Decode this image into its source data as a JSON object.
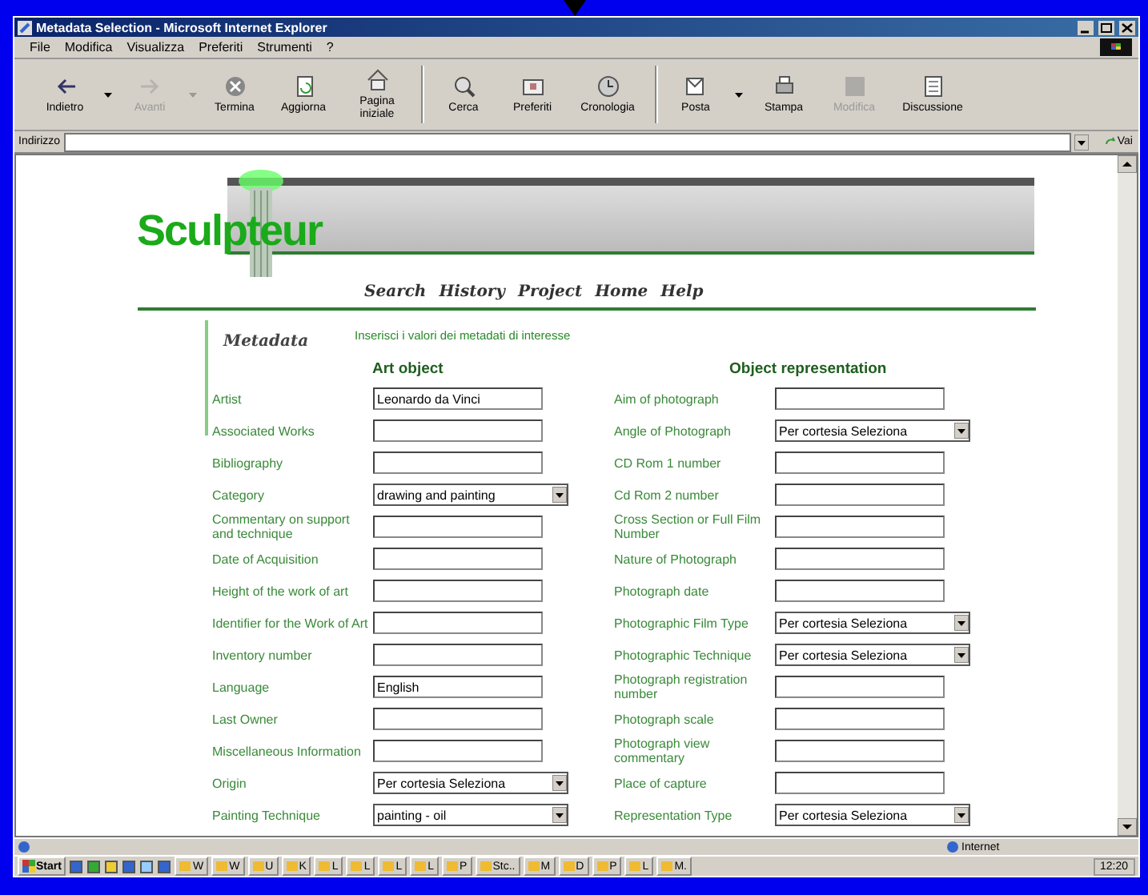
{
  "window": {
    "title": "Metadata Selection - Microsoft Internet Explorer"
  },
  "menu": [
    "File",
    "Modifica",
    "Visualizza",
    "Preferiti",
    "Strumenti",
    "?"
  ],
  "toolbar": [
    {
      "label": "Indietro",
      "disabled": false,
      "dropdown": true
    },
    {
      "label": "Avanti",
      "disabled": true,
      "dropdown": true
    },
    {
      "label": "Termina",
      "disabled": false,
      "dropdown": false
    },
    {
      "label": "Aggiorna",
      "disabled": false,
      "dropdown": false
    },
    {
      "label": "Pagina iniziale",
      "disabled": false,
      "dropdown": false
    },
    {
      "label": "Cerca",
      "disabled": false,
      "dropdown": false
    },
    {
      "label": "Preferiti",
      "disabled": false,
      "dropdown": false
    },
    {
      "label": "Cronologia",
      "disabled": false,
      "dropdown": false
    },
    {
      "label": "Posta",
      "disabled": false,
      "dropdown": true
    },
    {
      "label": "Stampa",
      "disabled": false,
      "dropdown": false
    },
    {
      "label": "Modifica",
      "disabled": true,
      "dropdown": false
    },
    {
      "label": "Discussione",
      "disabled": false,
      "dropdown": false
    }
  ],
  "address": {
    "label": "Indirizzo",
    "go": "Vai"
  },
  "page": {
    "logo": "Sculpteur",
    "nav": [
      "Search",
      "History",
      "Project",
      "Home",
      "Help"
    ],
    "section": "Metadata",
    "instruction": "Inserisci i valori dei metadati di interesse",
    "columns": [
      {
        "heading": "Art object",
        "fields": [
          {
            "label": "Artist",
            "kind": "text",
            "value": "Leonardo da Vinci"
          },
          {
            "label": "Associated Works",
            "kind": "text"
          },
          {
            "label": "Bibliography",
            "kind": "text"
          },
          {
            "label": "Category",
            "kind": "select",
            "value": "drawing and painting"
          },
          {
            "label": "Commentary on support and technique",
            "kind": "text"
          },
          {
            "label": "Date of Acquisition",
            "kind": "text"
          },
          {
            "label": "Height of the work of art",
            "kind": "text"
          },
          {
            "label": "Identifier for the Work of Art",
            "kind": "text"
          },
          {
            "label": "Inventory number",
            "kind": "text"
          },
          {
            "label": "Language",
            "kind": "text",
            "value": "English"
          },
          {
            "label": "Last Owner",
            "kind": "text"
          },
          {
            "label": "Miscellaneous Information",
            "kind": "text"
          },
          {
            "label": "Origin",
            "kind": "select",
            "value": "Per cortesia Seleziona"
          },
          {
            "label": "Painting Technique",
            "kind": "select",
            "value": "painting - oil"
          }
        ]
      },
      {
        "heading": "Object representation",
        "fields": [
          {
            "label": "Aim of photograph",
            "kind": "text"
          },
          {
            "label": "Angle of Photograph",
            "kind": "select",
            "value": "Per cortesia Seleziona"
          },
          {
            "label": "CD Rom 1 number",
            "kind": "text"
          },
          {
            "label": "Cd Rom 2 number",
            "kind": "text"
          },
          {
            "label": "Cross Section or Full Film Number",
            "kind": "text"
          },
          {
            "label": "Nature of Photograph",
            "kind": "text"
          },
          {
            "label": "Photograph date",
            "kind": "text"
          },
          {
            "label": "Photographic Film Type",
            "kind": "select",
            "value": "Per cortesia Seleziona"
          },
          {
            "label": "Photographic Technique",
            "kind": "select",
            "value": "Per cortesia Seleziona"
          },
          {
            "label": "Photograph registration number",
            "kind": "text"
          },
          {
            "label": "Photograph scale",
            "kind": "text"
          },
          {
            "label": "Photograph view commentary",
            "kind": "text"
          },
          {
            "label": "Place of capture",
            "kind": "text"
          },
          {
            "label": "Representation Type",
            "kind": "select",
            "value": "Per cortesia Seleziona"
          }
        ]
      }
    ]
  },
  "status_bar": {
    "zone": "Internet"
  },
  "taskbar": {
    "start": "Start",
    "buttons": [
      "W",
      "W",
      "U",
      "K",
      "L",
      "L",
      "L",
      "L",
      "P",
      "Stc..",
      "M",
      "D",
      "P",
      "L",
      "M."
    ],
    "clock": "12:20"
  }
}
